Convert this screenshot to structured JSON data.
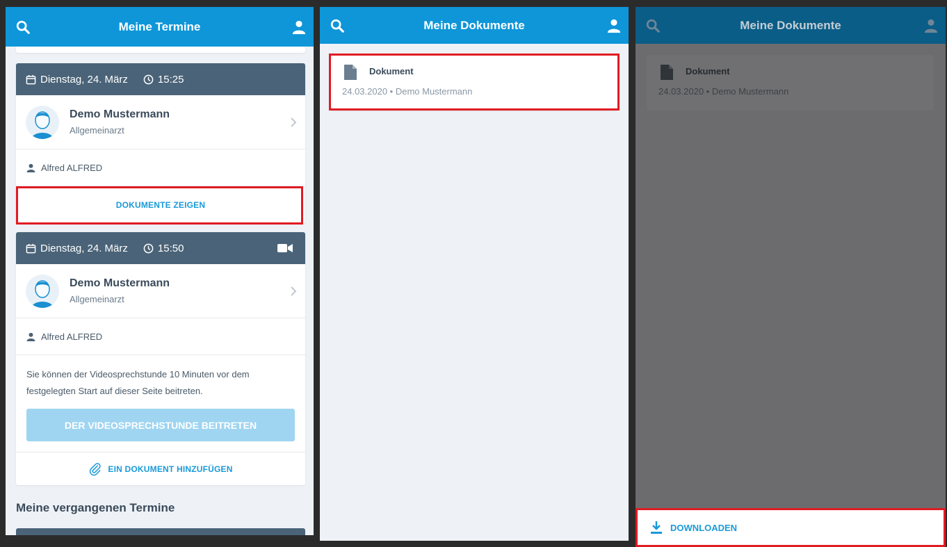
{
  "screen1": {
    "title": "Meine Termine",
    "appointments": [
      {
        "date": "Dienstag, 24. März",
        "time": "15:25",
        "doctor": "Demo Mustermann",
        "specialty": "Allgemeinarzt",
        "patient": "Alfred ALFRED",
        "action": "DOKUMENTE ZEIGEN"
      },
      {
        "date": "Dienstag, 24. März",
        "time": "15:50",
        "doctor": "Demo Mustermann",
        "specialty": "Allgemeinarzt",
        "patient": "Alfred ALFRED",
        "info": "Sie können der Videosprechstunde 10 Minuten vor dem festgelegten Start auf dieser Seite beitreten.",
        "join": "DER VIDEOSPRECHSTUNDE BEITRETEN",
        "add_doc": "EIN DOKUMENT HINZUFÜGEN"
      }
    ],
    "past_title": "Meine vergangenen Termine"
  },
  "screen2": {
    "title": "Meine Dokumente",
    "document": {
      "name": "Dokument",
      "meta": "24.03.2020 • Demo Mustermann"
    }
  },
  "screen3": {
    "title": "Meine Dokumente",
    "document": {
      "name": "Dokument",
      "meta": "24.03.2020 • Demo Mustermann"
    },
    "download": "DOWNLOADEN"
  },
  "colors": {
    "primary": "#0e96d9",
    "card_header": "#4a6378",
    "highlight": "#e11b22",
    "join_disabled": "#9fd5f1"
  }
}
